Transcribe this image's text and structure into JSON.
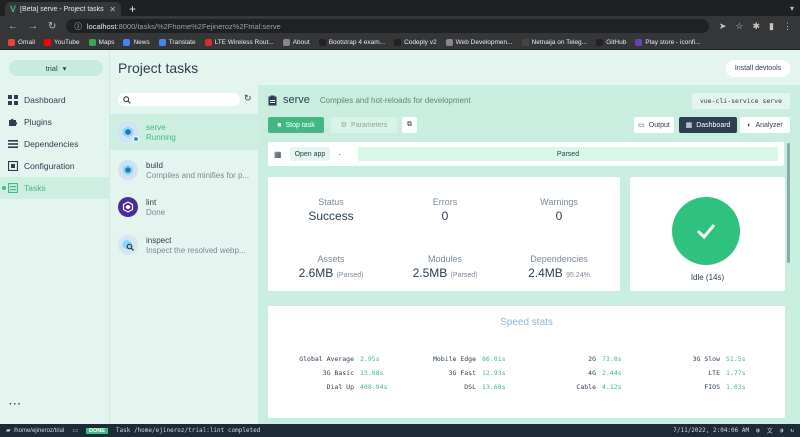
{
  "browser": {
    "tab_title": "[Beta] serve - Project tasks - ...",
    "url_host": "localhost",
    "url_rest": ":8000/tasks/%2Fhome%2Fejineroz%2Ftrial:serve",
    "bookmarks": [
      {
        "label": "Gmail",
        "color": "#ea4335"
      },
      {
        "label": "YouTube",
        "color": "#ff0000"
      },
      {
        "label": "Maps",
        "color": "#34a853"
      },
      {
        "label": "News",
        "color": "#4285f4"
      },
      {
        "label": "Translate",
        "color": "#4285f4"
      },
      {
        "label": "LTE Wireless Rout...",
        "color": "#d32f2f"
      },
      {
        "label": "About",
        "color": "#888888"
      },
      {
        "label": "Bootstrap 4 exam...",
        "color": "#222222"
      },
      {
        "label": "Codeply v2",
        "color": "#222222"
      },
      {
        "label": "Web Developmen...",
        "color": "#888888"
      },
      {
        "label": "Netnaija on Teleg...",
        "color": "#444444"
      },
      {
        "label": "GitHub",
        "color": "#222222"
      },
      {
        "label": "Play store - iconfi...",
        "color": "#6c3fb5"
      }
    ]
  },
  "sidebar": {
    "project": "trial",
    "items": [
      {
        "label": "Dashboard",
        "icon": "dashboard-icon"
      },
      {
        "label": "Plugins",
        "icon": "puzzle-icon"
      },
      {
        "label": "Dependencies",
        "icon": "dependencies-icon"
      },
      {
        "label": "Configuration",
        "icon": "gear-icon"
      },
      {
        "label": "Tasks",
        "icon": "tasks-icon",
        "active": true
      }
    ]
  },
  "header": {
    "title": "Project tasks",
    "devtools_label": "Install devtools"
  },
  "tasks": [
    {
      "name": "serve",
      "desc": "Running",
      "selected": true
    },
    {
      "name": "build",
      "desc": "Compiles and minifies for p..."
    },
    {
      "name": "lint",
      "desc": "Done"
    },
    {
      "name": "inspect",
      "desc": "Inspect the resolved webp..."
    }
  ],
  "detail": {
    "name": "serve",
    "description": "Compiles and hot-reloads for development",
    "command": "vue-cli-service serve",
    "stop_label": "Stop task",
    "params_label": "Parameters",
    "output_label": "Output",
    "dashboard_label": "Dashboard",
    "analyzer_label": "Analyzer",
    "open_app_label": "Open app",
    "progress_label": "Parsed",
    "stats": {
      "status_label": "Status",
      "status_value": "Success",
      "errors_label": "Errors",
      "errors_value": "0",
      "warnings_label": "Warnings",
      "warnings_value": "0",
      "assets_label": "Assets",
      "assets_value": "2.6MB",
      "assets_sub": "(Parsed)",
      "modules_label": "Modules",
      "modules_value": "2.5MB",
      "modules_sub": "(Parsed)",
      "deps_label": "Dependencies",
      "deps_value": "2.4MB",
      "deps_sub": "95.24%"
    },
    "idle_label": "Idle (14s)",
    "speed_title": "Speed stats",
    "speed": [
      {
        "k": "Global Average",
        "v": "2.95s"
      },
      {
        "k": "Mobile Edge",
        "v": "86.01s"
      },
      {
        "k": "2G",
        "v": "73.8s"
      },
      {
        "k": "3G Slow",
        "v": "51.5s"
      },
      {
        "k": "3G Basic",
        "v": "13.08s"
      },
      {
        "k": "3G Fast",
        "v": "12.93s"
      },
      {
        "k": "4G",
        "v": "2.44s"
      },
      {
        "k": "LTE",
        "v": "1.77s"
      },
      {
        "k": "Dial Up",
        "v": "408.94s"
      },
      {
        "k": "DSL",
        "v": "13.68s"
      },
      {
        "k": "Cable",
        "v": "4.12s"
      },
      {
        "k": "FIOS",
        "v": "1.03s"
      }
    ]
  },
  "statusbar": {
    "dir": "/home/ejineroz/trial",
    "badge": "DONE",
    "message": "Task /home/ejineroz/trial:lint completed",
    "time": "7/11/2022, 2:04:06 AM"
  }
}
